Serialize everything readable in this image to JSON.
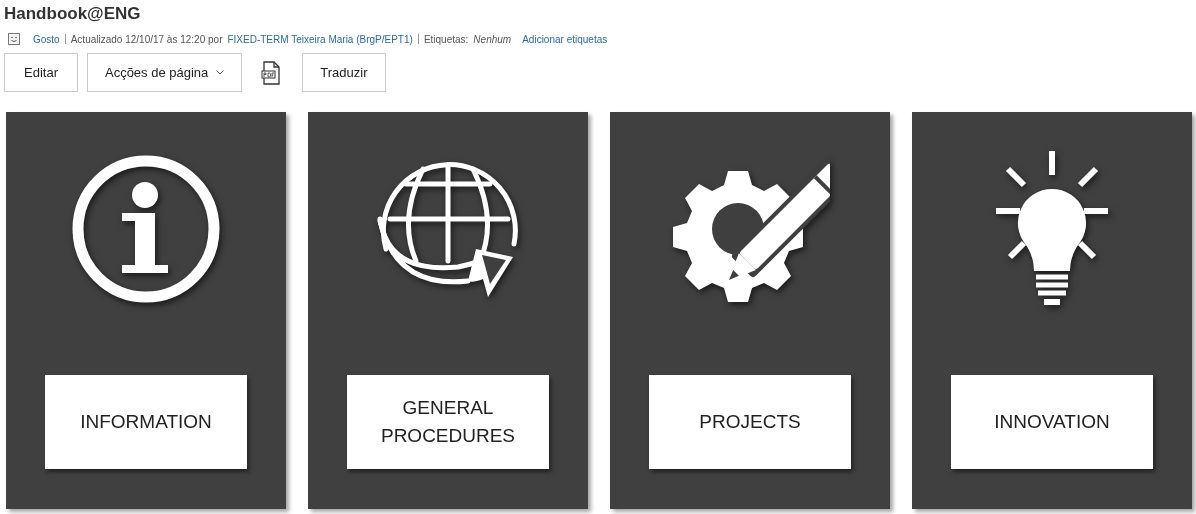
{
  "page": {
    "title": "Handbook@ENG"
  },
  "meta": {
    "like": "Gosto",
    "updated": "Actualizado 12/10/17 às 12:20 por",
    "author": "FIXED-TERM Teixeira Maria (BrgP/EPT1)",
    "tags_label": "Etiquetas:",
    "tags_value": "Nenhum",
    "add_tags": "Adicionar etiquetas"
  },
  "toolbar": [
    {
      "kind": "button",
      "label": "Editar"
    },
    {
      "kind": "dropdown",
      "label": "Acções de página"
    },
    {
      "kind": "pdf"
    },
    {
      "kind": "button",
      "label": "Traduzir"
    }
  ],
  "cards": [
    {
      "kind": "info",
      "label": "INFORMATION"
    },
    {
      "kind": "globe",
      "label": "GENERAL\nPROCEDURES"
    },
    {
      "kind": "gear",
      "label": "PROJECTS"
    },
    {
      "kind": "bulb",
      "label": "INNOVATION"
    }
  ]
}
